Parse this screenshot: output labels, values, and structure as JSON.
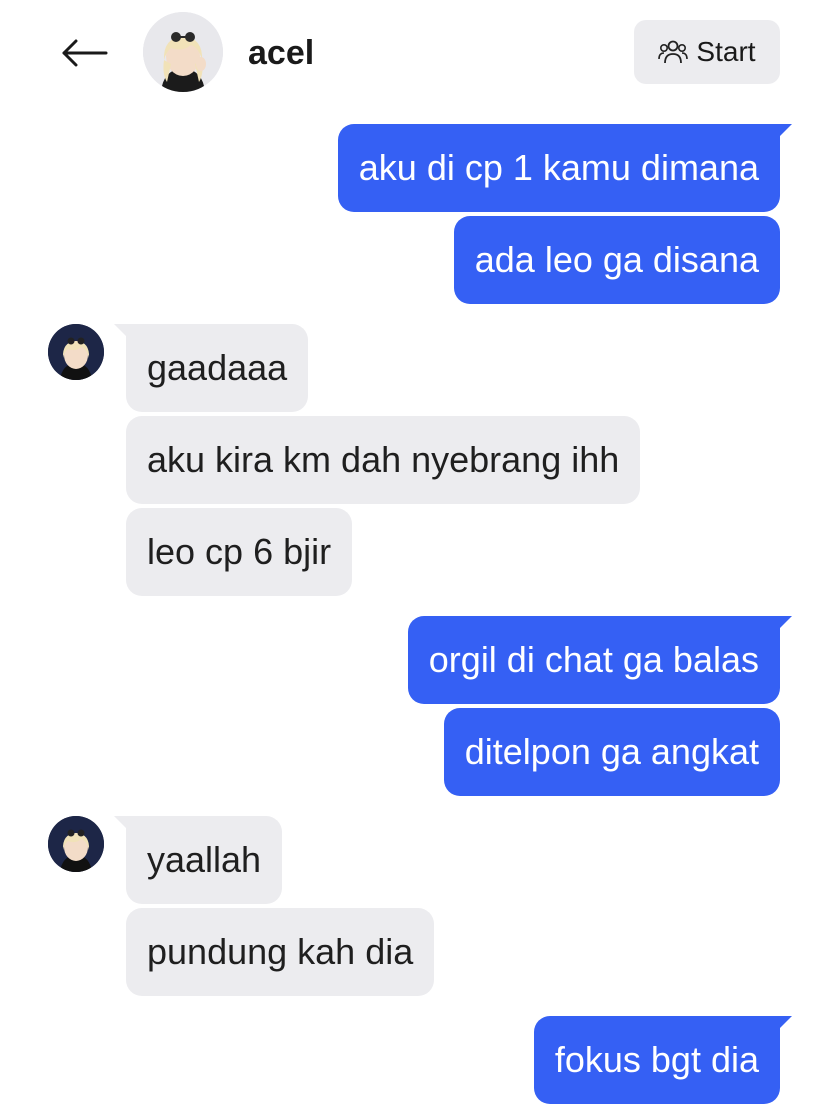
{
  "header": {
    "contact_name": "acel",
    "start_label": "Start",
    "icons": {
      "back": "arrow-left-icon",
      "start": "people-icon",
      "avatar": "contact-avatar"
    }
  },
  "colors": {
    "outgoing_bubble": "#3560f4",
    "incoming_bubble": "#ececef",
    "outgoing_text": "#ffffff",
    "incoming_text": "#1f1f1f"
  },
  "messages": [
    {
      "direction": "out",
      "text": "aku di cp 1 kamu dimana"
    },
    {
      "direction": "out",
      "text": "ada leo ga disana"
    },
    {
      "direction": "in",
      "text": "gaadaaa"
    },
    {
      "direction": "in",
      "text": "aku kira km dah nyebrang ihh"
    },
    {
      "direction": "in",
      "text": "leo cp 6 bjir"
    },
    {
      "direction": "out",
      "text": "orgil di chat ga balas"
    },
    {
      "direction": "out",
      "text": "ditelpon ga angkat"
    },
    {
      "direction": "in",
      "text": "yaallah"
    },
    {
      "direction": "in",
      "text": "pundung kah dia"
    },
    {
      "direction": "out",
      "text": "fokus bgt dia"
    }
  ]
}
